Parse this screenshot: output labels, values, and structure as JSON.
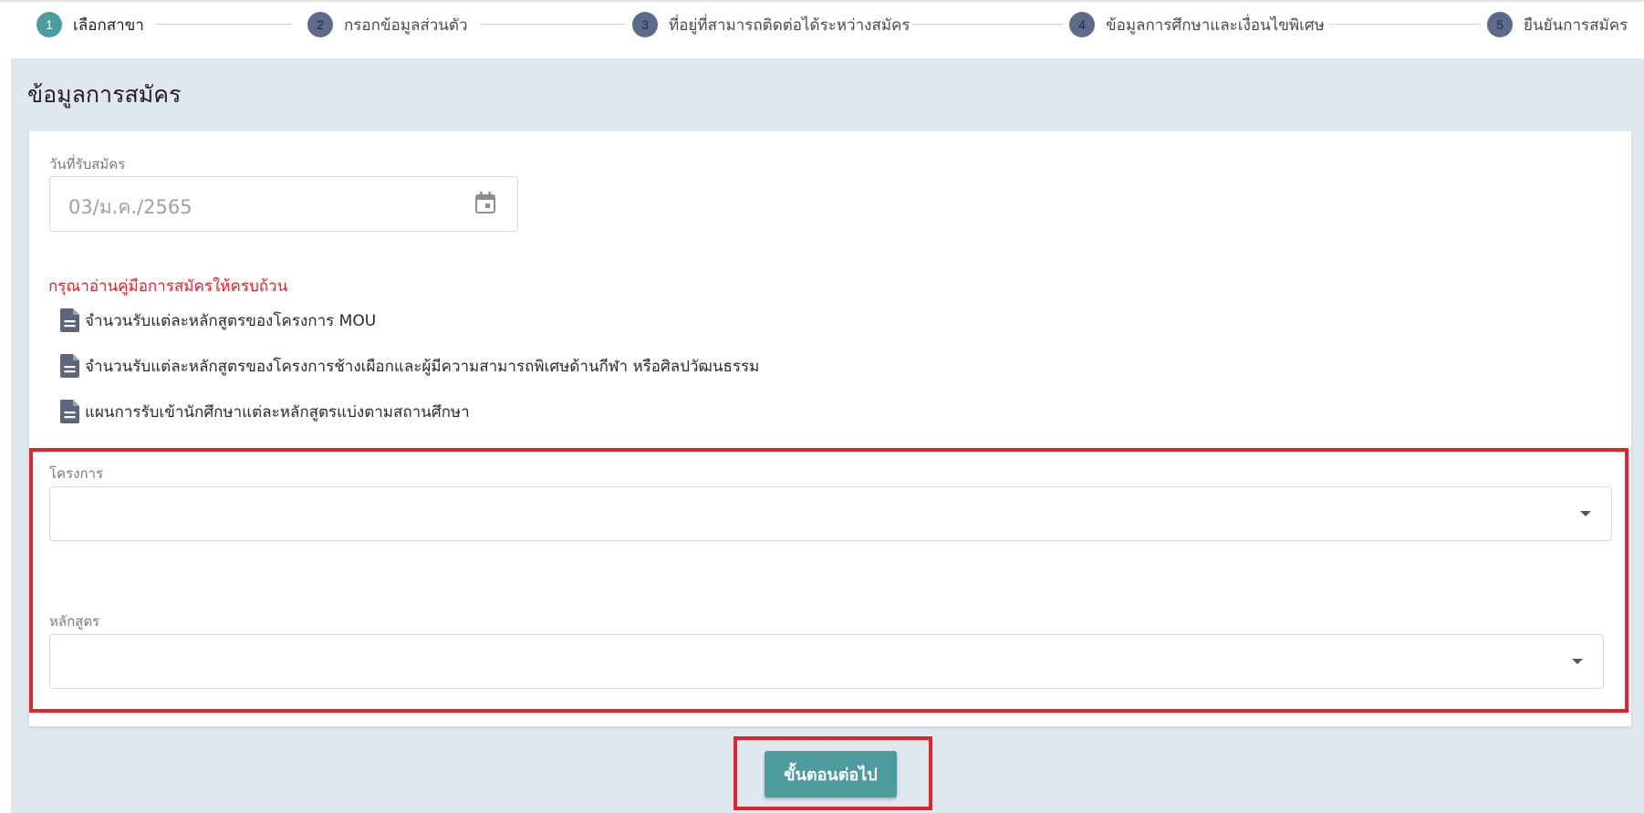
{
  "stepper": {
    "steps": [
      {
        "number": "1",
        "label": "เลือกสาขา",
        "state": "active"
      },
      {
        "number": "2",
        "label": "กรอกข้อมูลส่วนตัว",
        "state": "inactive"
      },
      {
        "number": "3",
        "label": "ที่อยู่ที่สามารถติดต่อได้ระหว่างสมัคร",
        "state": "inactive"
      },
      {
        "number": "4",
        "label": "ข้อมูลการศึกษาและเงื่อนไขพิเศษ",
        "state": "inactive"
      },
      {
        "number": "5",
        "label": "ยืนยันการสมัคร",
        "state": "inactive"
      }
    ]
  },
  "main": {
    "title": "ข้อมูลการสมัคร",
    "date_field": {
      "label": "วันที่รับสมัคร",
      "value": "03/ม.ค./2565",
      "icon": "calendar-icon"
    },
    "warning": "กรุณาอ่านคู่มือการสมัครให้ครบถ้วน",
    "documents": [
      {
        "label": "จำนวนรับแต่ละหลักสูตรของโครงการ MOU",
        "icon": "document-icon"
      },
      {
        "label": "จำนวนรับแต่ละหลักสูตรของโครงการช้างเผือกและผู้มีความสามารถพิเศษด้านกีฬา หรือศิลปวัฒนธรรม",
        "icon": "document-icon"
      },
      {
        "label": "แผนการรับเข้านักศึกษาแต่ละหลักสูตรแบ่งตามสถานศึกษา",
        "icon": "document-icon"
      }
    ],
    "project_select": {
      "label": "โครงการ",
      "value": ""
    },
    "course_select": {
      "label": "หลักสูตร",
      "value": ""
    },
    "next_button": "ขั้นตอนต่อไป"
  },
  "colors": {
    "accent": "#4e9b9d",
    "step_inactive": "#5b6b89",
    "highlight": "#e0232c",
    "warning_text": "#e0232c",
    "page_background": "#e1e7ef"
  }
}
